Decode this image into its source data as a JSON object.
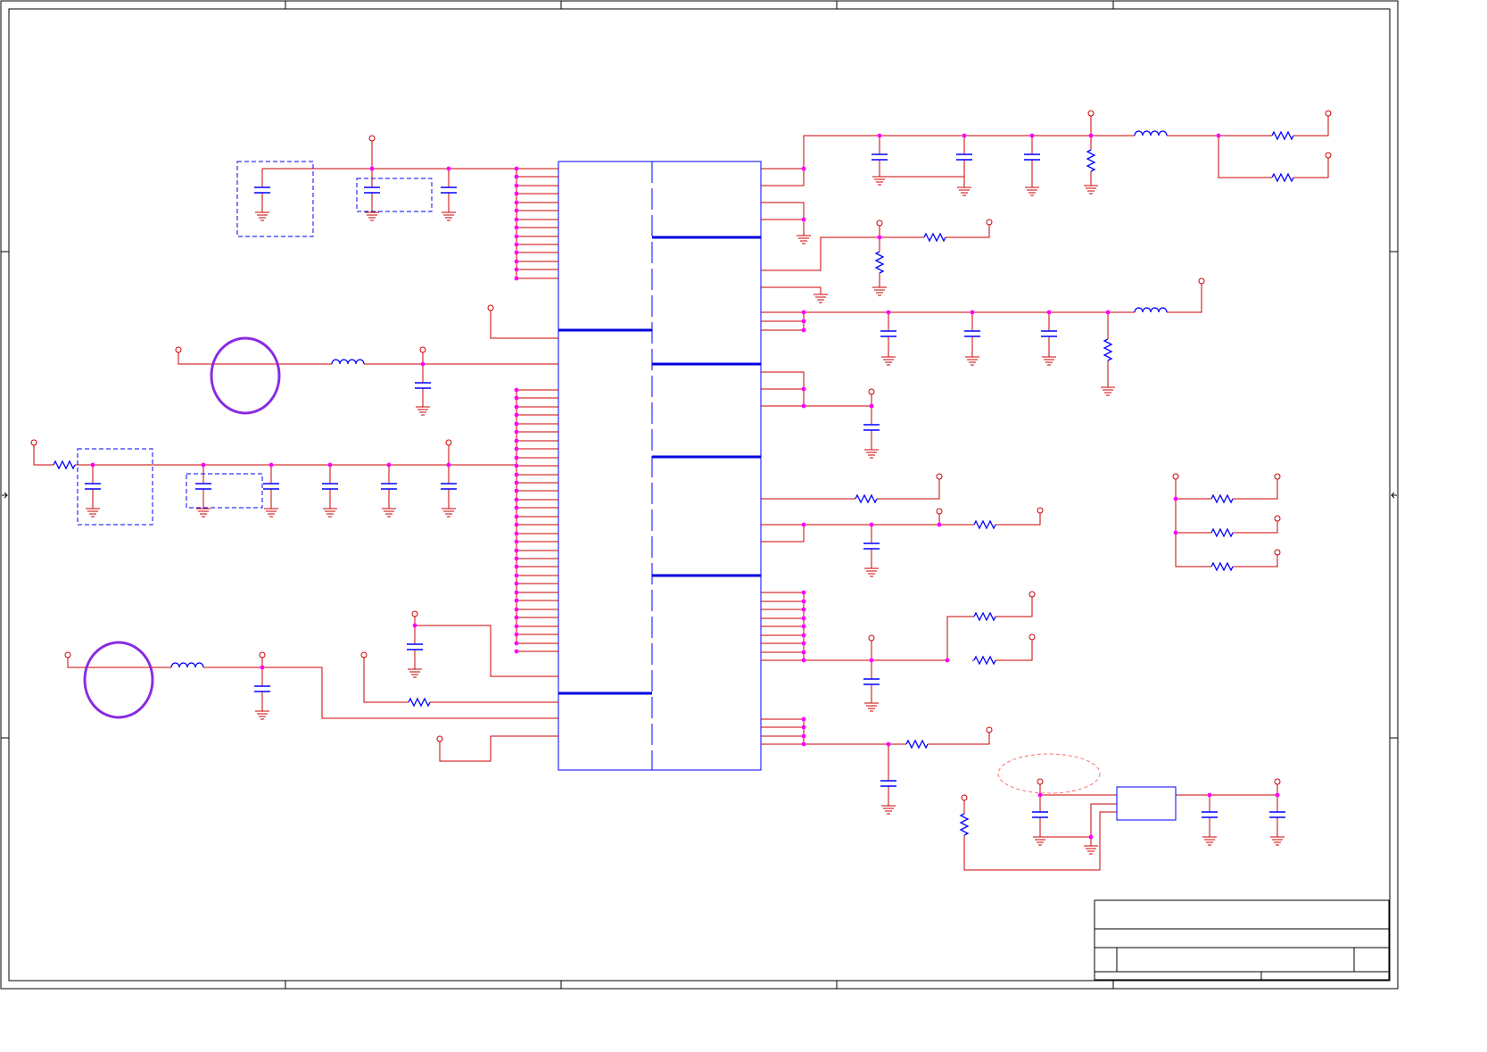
{
  "colors": {
    "wire": "#cc0000",
    "junction": "#ff00ff",
    "component": "#0000ff",
    "ic_outline": "#0000ff",
    "bus": "#0000e0",
    "frame": "#000000",
    "highlight_circle": "#8a2be2",
    "dashed_box": "#0000ff",
    "dashed_ellipse": "#ff7070"
  },
  "title_block": {
    "title": "",
    "document_number": "",
    "size": "",
    "revision": "",
    "date": "",
    "sheet": ""
  }
}
